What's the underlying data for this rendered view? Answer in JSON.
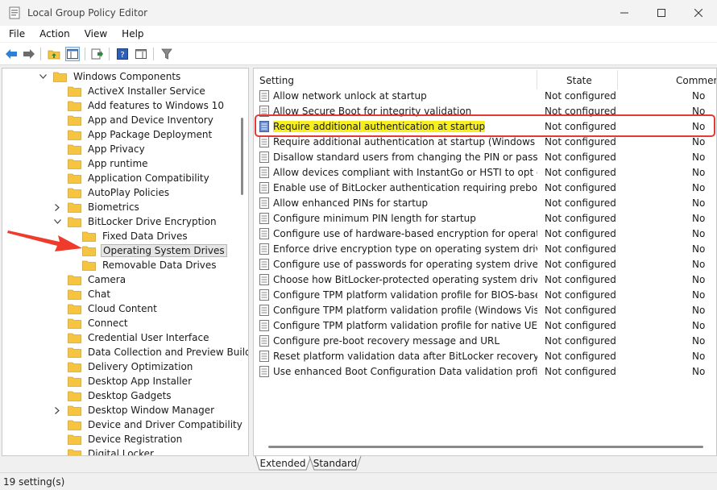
{
  "window": {
    "title": "Local Group Policy Editor"
  },
  "menu": [
    "File",
    "Action",
    "View",
    "Help"
  ],
  "tree": {
    "root": {
      "label": "Windows Components",
      "expanded": true
    },
    "items": [
      {
        "label": "ActiveX Installer Service",
        "level": 1,
        "expander": "none"
      },
      {
        "label": "Add features to Windows 10",
        "level": 1,
        "expander": "none"
      },
      {
        "label": "App and Device Inventory",
        "level": 1,
        "expander": "none"
      },
      {
        "label": "App Package Deployment",
        "level": 1,
        "expander": "none"
      },
      {
        "label": "App Privacy",
        "level": 1,
        "expander": "none"
      },
      {
        "label": "App runtime",
        "level": 1,
        "expander": "none"
      },
      {
        "label": "Application Compatibility",
        "level": 1,
        "expander": "none"
      },
      {
        "label": "AutoPlay Policies",
        "level": 1,
        "expander": "none"
      },
      {
        "label": "Biometrics",
        "level": 1,
        "expander": "collapsed"
      },
      {
        "label": "BitLocker Drive Encryption",
        "level": 1,
        "expander": "expanded"
      },
      {
        "label": "Fixed Data Drives",
        "level": 2,
        "expander": "none"
      },
      {
        "label": "Operating System Drives",
        "level": 2,
        "expander": "none",
        "selected": true
      },
      {
        "label": "Removable Data Drives",
        "level": 2,
        "expander": "none"
      },
      {
        "label": "Camera",
        "level": 1,
        "expander": "none"
      },
      {
        "label": "Chat",
        "level": 1,
        "expander": "none"
      },
      {
        "label": "Cloud Content",
        "level": 1,
        "expander": "none"
      },
      {
        "label": "Connect",
        "level": 1,
        "expander": "none"
      },
      {
        "label": "Credential User Interface",
        "level": 1,
        "expander": "none"
      },
      {
        "label": "Data Collection and Preview Builds",
        "level": 1,
        "expander": "none"
      },
      {
        "label": "Delivery Optimization",
        "level": 1,
        "expander": "none"
      },
      {
        "label": "Desktop App Installer",
        "level": 1,
        "expander": "none"
      },
      {
        "label": "Desktop Gadgets",
        "level": 1,
        "expander": "none"
      },
      {
        "label": "Desktop Window Manager",
        "level": 1,
        "expander": "collapsed"
      },
      {
        "label": "Device and Driver Compatibility",
        "level": 1,
        "expander": "none"
      },
      {
        "label": "Device Registration",
        "level": 1,
        "expander": "none"
      },
      {
        "label": "Digital Locker",
        "level": 1,
        "expander": "none"
      }
    ]
  },
  "list": {
    "columns": {
      "setting": "Setting",
      "state": "State",
      "comment": "Commer"
    },
    "rows": [
      {
        "setting": "Allow network unlock at startup",
        "state": "Not configured",
        "comment": "No"
      },
      {
        "setting": "Allow Secure Boot for integrity validation",
        "state": "Not configured",
        "comment": "No"
      },
      {
        "setting": "Require additional authentication at startup",
        "state": "Not configured",
        "comment": "No",
        "highlighted": true
      },
      {
        "setting": "Require additional authentication at startup (Windows Server...",
        "state": "Not configured",
        "comment": "No"
      },
      {
        "setting": "Disallow standard users from changing the PIN or password",
        "state": "Not configured",
        "comment": "No"
      },
      {
        "setting": "Allow devices compliant with InstantGo or HSTI to opt out o...",
        "state": "Not configured",
        "comment": "No"
      },
      {
        "setting": "Enable use of BitLocker authentication requiring preboot ke...",
        "state": "Not configured",
        "comment": "No"
      },
      {
        "setting": "Allow enhanced PINs for startup",
        "state": "Not configured",
        "comment": "No"
      },
      {
        "setting": "Configure minimum PIN length for startup",
        "state": "Not configured",
        "comment": "No"
      },
      {
        "setting": "Configure use of hardware-based encryption for operating s...",
        "state": "Not configured",
        "comment": "No"
      },
      {
        "setting": "Enforce drive encryption type on operating system drives",
        "state": "Not configured",
        "comment": "No"
      },
      {
        "setting": "Configure use of passwords for operating system drives",
        "state": "Not configured",
        "comment": "No"
      },
      {
        "setting": "Choose how BitLocker-protected operating system drives ca...",
        "state": "Not configured",
        "comment": "No"
      },
      {
        "setting": "Configure TPM platform validation profile for BIOS-based fi...",
        "state": "Not configured",
        "comment": "No"
      },
      {
        "setting": "Configure TPM platform validation profile (Windows Vista, ...",
        "state": "Not configured",
        "comment": "No"
      },
      {
        "setting": "Configure TPM platform validation profile for native UEFI fir...",
        "state": "Not configured",
        "comment": "No"
      },
      {
        "setting": "Configure pre-boot recovery message and URL",
        "state": "Not configured",
        "comment": "No"
      },
      {
        "setting": "Reset platform validation data after BitLocker recovery",
        "state": "Not configured",
        "comment": "No"
      },
      {
        "setting": "Use enhanced Boot Configuration Data validation profile",
        "state": "Not configured",
        "comment": "No"
      }
    ]
  },
  "tabs": [
    {
      "label": "Extended",
      "active": false
    },
    {
      "label": "Standard",
      "active": true
    }
  ],
  "status": {
    "text": "19 setting(s)"
  },
  "colors": {
    "highlight": "#f7ef1e",
    "annotation": "#e53935",
    "folder": "#f5c542"
  }
}
